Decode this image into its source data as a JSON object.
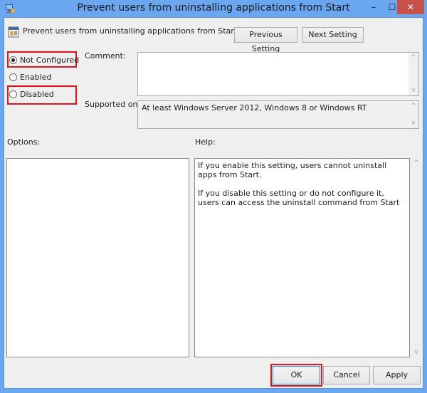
{
  "window": {
    "title": "Prevent users from uninstalling applications from Start",
    "minimize_glyph": "–",
    "maximize_glyph": "☐",
    "close_glyph": "✕"
  },
  "header": {
    "setting_name": "Prevent users from uninstalling applications from Start",
    "previous_label": "Previous Setting",
    "next_label": "Next Setting"
  },
  "state": {
    "options": [
      {
        "label": "Not Configured",
        "checked": true,
        "highlighted": true
      },
      {
        "label": "Enabled",
        "checked": false,
        "highlighted": false
      },
      {
        "label": "Disabled",
        "checked": false,
        "highlighted": true
      }
    ]
  },
  "comment": {
    "label": "Comment:",
    "value": ""
  },
  "supported": {
    "label": "Supported on:",
    "value": "At least Windows Server 2012, Windows 8 or Windows RT"
  },
  "options_panel": {
    "label": "Options:"
  },
  "help_panel": {
    "label": "Help:",
    "paragraphs": [
      "If you enable this setting, users cannot uninstall apps from Start.",
      "If you disable this setting or do not configure it, users can access the uninstall command from Start"
    ]
  },
  "footer": {
    "ok_label": "OK",
    "cancel_label": "Cancel",
    "apply_label": "Apply"
  },
  "scroll": {
    "up_glyph": "^",
    "down_glyph": "v"
  },
  "colors": {
    "frame": "#6aa7f0",
    "close": "#c7504a",
    "highlight": "#e0141e"
  }
}
